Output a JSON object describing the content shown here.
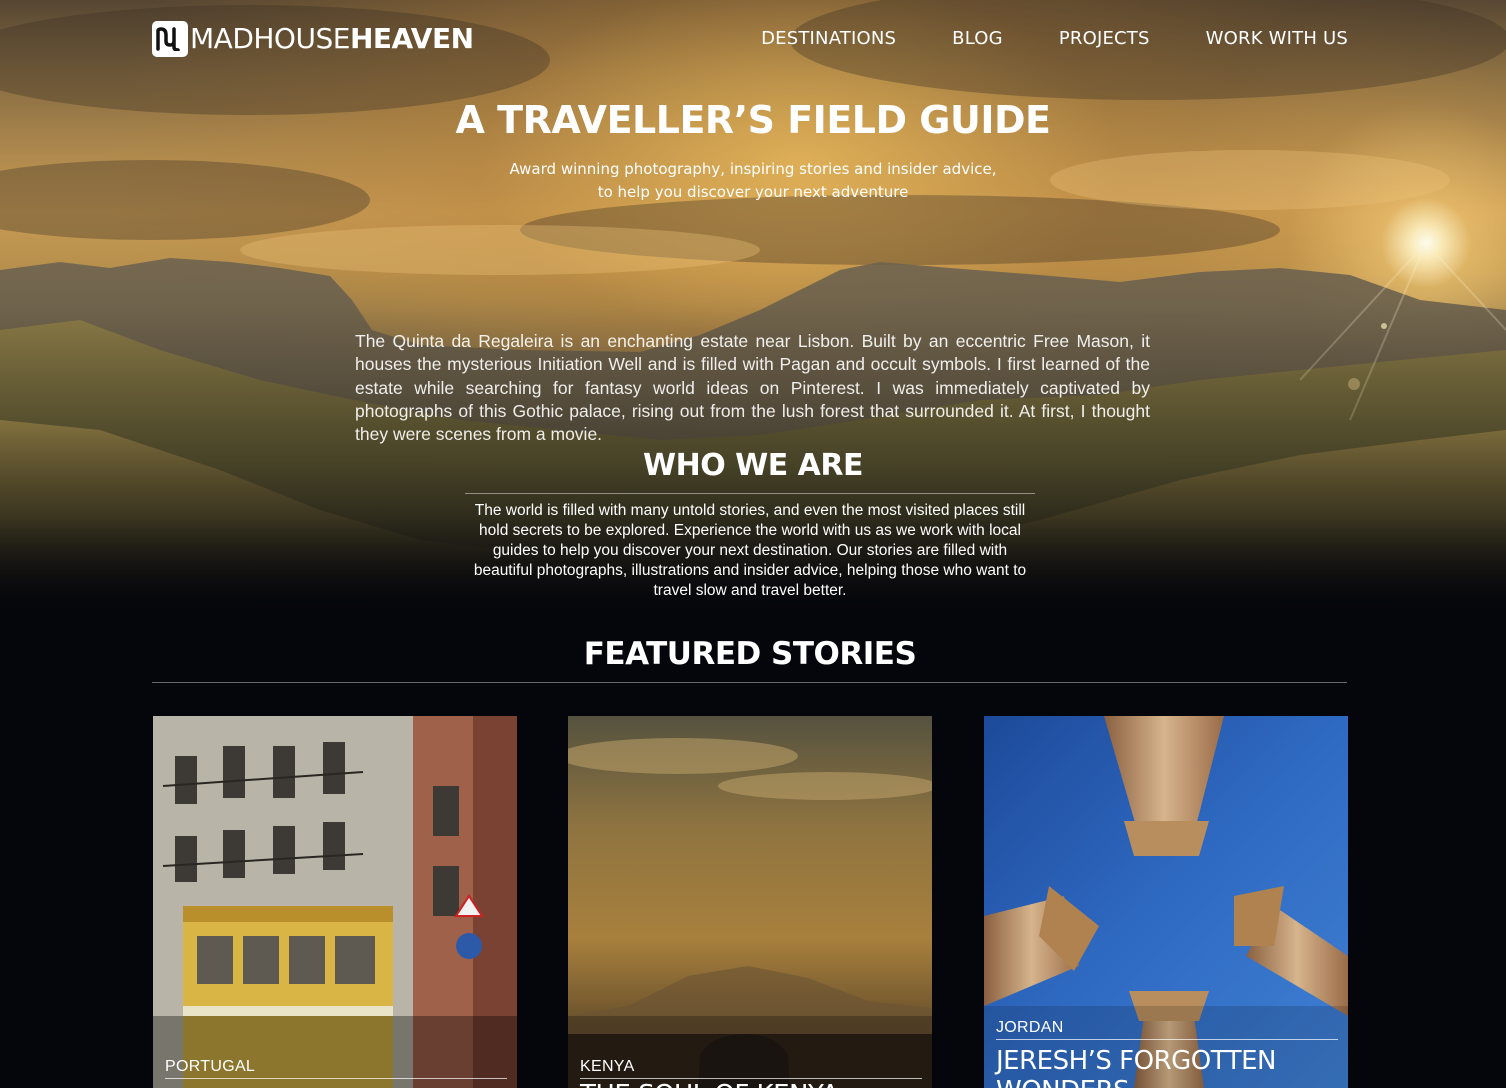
{
  "logo": {
    "mark": "logo-mark-icon",
    "text_light": "MADHOUSE",
    "text_bold": "HEAVEN"
  },
  "nav": [
    {
      "label": "DESTINATIONS"
    },
    {
      "label": "BLOG"
    },
    {
      "label": "PROJECTS"
    },
    {
      "label": "WORK WITH US"
    }
  ],
  "hero": {
    "title": "A TRAVELLER’S FIELD GUIDE",
    "subtitle_line1": "Award winning photography, inspiring stories and insider advice,",
    "subtitle_line2": "to help you discover your next adventure",
    "intro": "The Quinta da Regaleira is an enchanting estate near Lisbon. Built by an eccentric Free Mason, it houses the mysterious Initiation Well and is filled with Pagan and occult symbols. I first learned of the estate while searching for fantasy world ideas on Pinterest. I was immediately captivated by photographs of this Gothic palace, rising out from the lush forest that surrounded it. At first, I thought they were scenes from a movie."
  },
  "who": {
    "title": "WHO WE ARE",
    "body": "The world is filled with many untold stories, and even the most visited places still hold secrets to be explored. Experience the world with us as we work with local guides to help you discover your next destination. Our stories are filled with beautiful photographs, illustrations and insider advice, helping those who want to travel slow and travel better."
  },
  "featured": {
    "title": "FEATURED STORIES",
    "cards": [
      {
        "location": "PORTUGAL",
        "title": ""
      },
      {
        "location": "KENYA",
        "title": "THE SOUL OF KENYA"
      },
      {
        "location": "JORDAN",
        "title": "JERESH’S FORGOTTEN",
        "title_line2": "WONDERS"
      }
    ]
  },
  "colors": {
    "page_bg": "#05060c",
    "text": "#ffffff",
    "sky_gold": "#c99c55",
    "jordan_sky": "#2b63b8"
  }
}
